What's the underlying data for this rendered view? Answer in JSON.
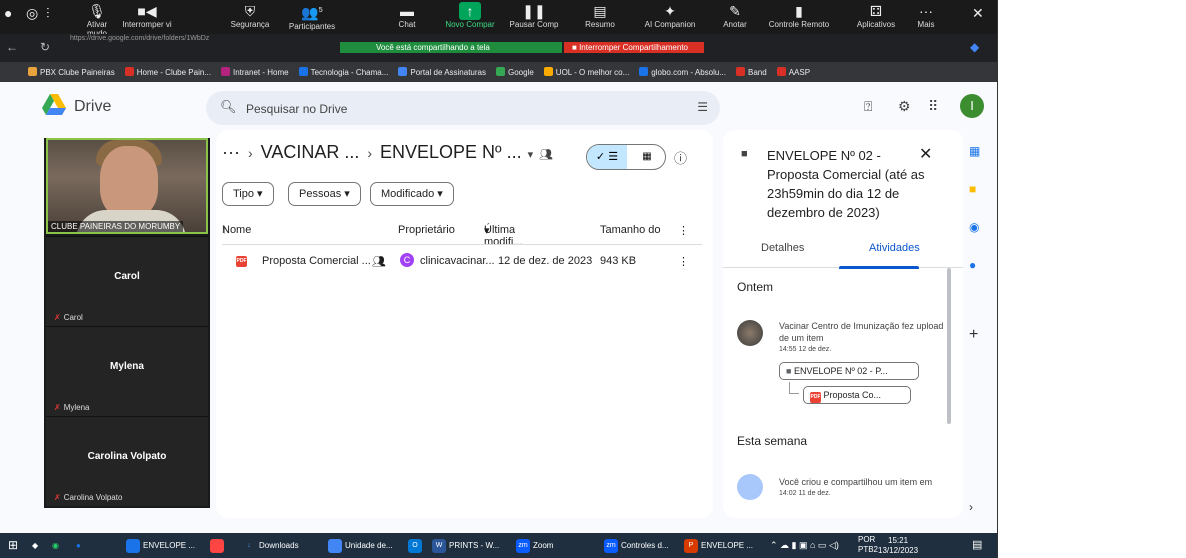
{
  "zoom_toolbar": {
    "items": [
      {
        "label": "Ativar mudo",
        "icon": "microphone-icon"
      },
      {
        "label": "Interromper vi",
        "icon": "video-icon"
      },
      {
        "label": "Segurança",
        "icon": "shield-icon"
      },
      {
        "label": "Participantes",
        "icon": "participants-icon",
        "badge": "5"
      },
      {
        "label": "Chat",
        "icon": "chat-icon"
      },
      {
        "label": "Novo Compar",
        "icon": "share-screen-icon"
      },
      {
        "label": "Pausar Comp",
        "icon": "pause-icon"
      },
      {
        "label": "Resumo",
        "icon": "summary-icon"
      },
      {
        "label": "AI Companion",
        "icon": "ai-sparkle-icon"
      },
      {
        "label": "Anotar",
        "icon": "pen-icon"
      },
      {
        "label": "Controle Remoto",
        "icon": "mouse-icon"
      },
      {
        "label": "Aplicativos",
        "icon": "apps-icon"
      },
      {
        "label": "Mais",
        "icon": "more-icon"
      }
    ],
    "sharing_banner": "Você está compartilhando a tela",
    "stop_sharing": "Interromper Compartilhamento",
    "url_fragment": "https://drive.google.com/drive/folders/1WbDz"
  },
  "bookmarks": [
    {
      "label": "PBX Clube Paineiras",
      "color": "#e8a33d"
    },
    {
      "label": "Home - Clube Pain...",
      "color": "#d93025"
    },
    {
      "label": "Intranet - Home",
      "color": "#b4247e"
    },
    {
      "label": "Tecnologia - Chama...",
      "color": "#1a73e8"
    },
    {
      "label": "Portal de Assinaturas",
      "color": "#4285f4"
    },
    {
      "label": "Google",
      "color": "#34a853"
    },
    {
      "label": "UOL - O melhor co...",
      "color": "#f9ab00"
    },
    {
      "label": "globo.com - Absolu...",
      "color": "#1a73e8"
    },
    {
      "label": "Band",
      "color": "#d93025"
    },
    {
      "label": "AASP",
      "color": "#d93025"
    }
  ],
  "drive": {
    "title": "Drive",
    "search_placeholder": "Pesquisar no Drive",
    "avatar_letter": "I",
    "breadcrumb": [
      "VACINAR ...",
      "ENVELOPE Nº ..."
    ],
    "filters": [
      "Tipo",
      "Pessoas",
      "Modificado"
    ],
    "columns": [
      "Nome",
      "Proprietário",
      "Última modifi...",
      "Tamanho do"
    ],
    "file": {
      "name": "Proposta Comercial ...",
      "owner": "clinicavacinar...",
      "owner_initial": "C",
      "modified": "12 de dez. de 2023",
      "size": "943 KB"
    }
  },
  "details": {
    "title": "ENVELOPE Nº 02 - Proposta Comercial (até as 23h59min do dia 12 de dezembro de 2023)",
    "tab_details": "Detalhes",
    "tab_activity": "Atividades",
    "section1": "Ontem",
    "activity1": "Vacinar Centro de Imunização fez upload de um item",
    "activity1_time": "14:55 12 de dez.",
    "activity1_folder": "ENVELOPE Nº 02 - P...",
    "activity1_file": "Proposta Co...",
    "section2": "Esta semana",
    "activity2": "Você criou e compartilhou um item em",
    "activity2_time": "14:02 11 de dez."
  },
  "zoom_participants": {
    "self_name": "CLUBE PAINEIRAS DO MORUMBY",
    "tiles": [
      "Carol",
      "Mylena",
      "Carolina Volpato"
    ]
  },
  "taskbar": {
    "items": [
      {
        "label": "ENVELOPE ...",
        "color": "#1a73e8"
      },
      {
        "label": "Downloads",
        "color": "#f9ab00"
      },
      {
        "label": "Unidade de...",
        "color": "#4285f4"
      },
      {
        "label": "PRINTS - W...",
        "color": "#2b579a"
      },
      {
        "label": "Zoom",
        "color": "#0b5cff"
      },
      {
        "label": "Controles d...",
        "color": "#0b5cff"
      },
      {
        "label": "ENVELOPE ...",
        "color": "#d83b01"
      }
    ],
    "lang": "POR",
    "lang2": "PTB2",
    "time": "15:21",
    "date": "13/12/2023"
  }
}
